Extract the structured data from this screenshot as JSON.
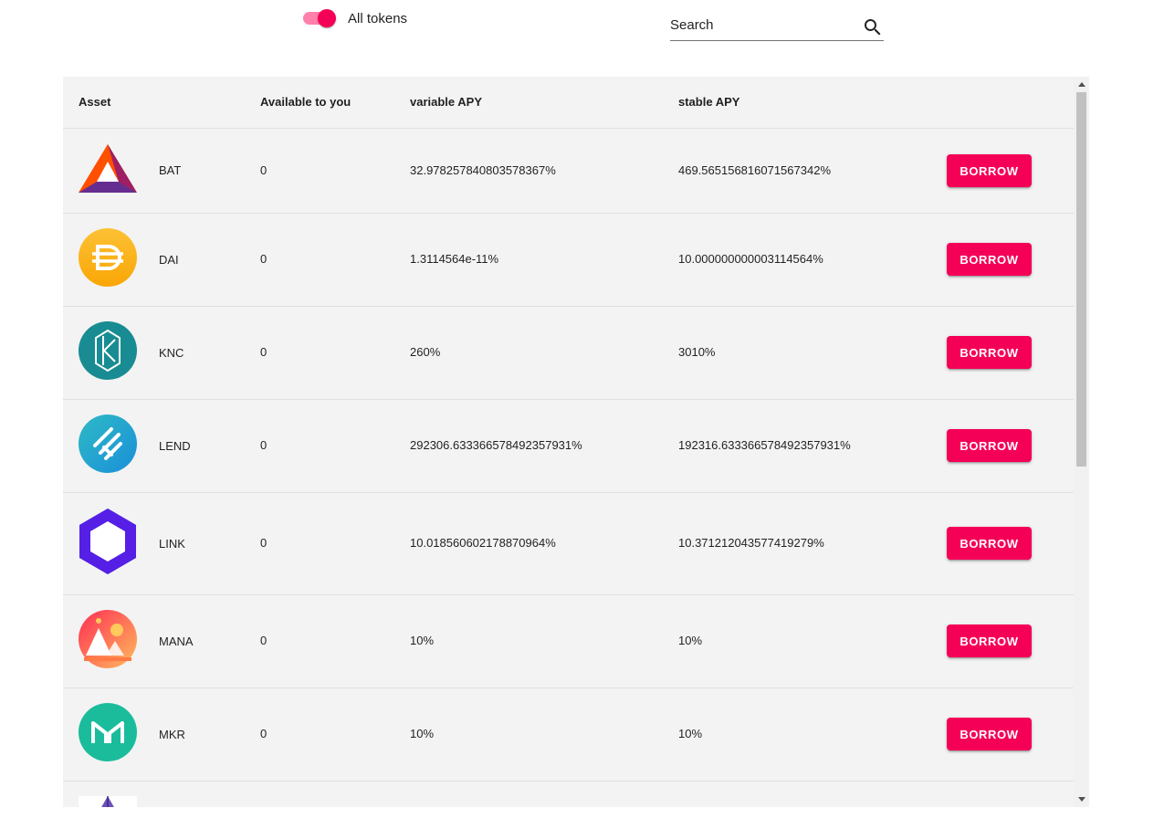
{
  "toolbar": {
    "toggle_label": "All tokens",
    "toggle_on": true,
    "search_placeholder": "Search"
  },
  "table": {
    "headers": {
      "asset": "Asset",
      "available": "Available to you",
      "variable_apy": "variable APY",
      "stable_apy": "stable APY"
    },
    "rows": [
      {
        "symbol": "BAT",
        "icon": "bat-logo-icon",
        "available": "0",
        "variable_apy": "32.978257840803578367%",
        "stable_apy": "469.565156816071567342%",
        "action": "BORROW"
      },
      {
        "symbol": "DAI",
        "icon": "dai-logo-icon",
        "available": "0",
        "variable_apy": "1.3114564e-11%",
        "stable_apy": "10.000000000003114564%",
        "action": "BORROW"
      },
      {
        "symbol": "KNC",
        "icon": "knc-logo-icon",
        "available": "0",
        "variable_apy": "260%",
        "stable_apy": "3010%",
        "action": "BORROW"
      },
      {
        "symbol": "LEND",
        "icon": "lend-logo-icon",
        "available": "0",
        "variable_apy": "292306.633366578492357931%",
        "stable_apy": "192316.633366578492357931%",
        "action": "BORROW"
      },
      {
        "symbol": "LINK",
        "icon": "link-logo-icon",
        "available": "0",
        "variable_apy": "10.018560602178870964%",
        "stable_apy": "10.371212043577419279%",
        "action": "BORROW"
      },
      {
        "symbol": "MANA",
        "icon": "mana-logo-icon",
        "available": "0",
        "variable_apy": "10%",
        "stable_apy": "10%",
        "action": "BORROW"
      },
      {
        "symbol": "MKR",
        "icon": "mkr-logo-icon",
        "available": "0",
        "variable_apy": "10%",
        "stable_apy": "10%",
        "action": "BORROW"
      }
    ]
  },
  "colors": {
    "accent": "#f50057",
    "switch_track": "#ff80ab",
    "panel_background": "#f3f3f3",
    "divider": "#e0e0e0"
  }
}
